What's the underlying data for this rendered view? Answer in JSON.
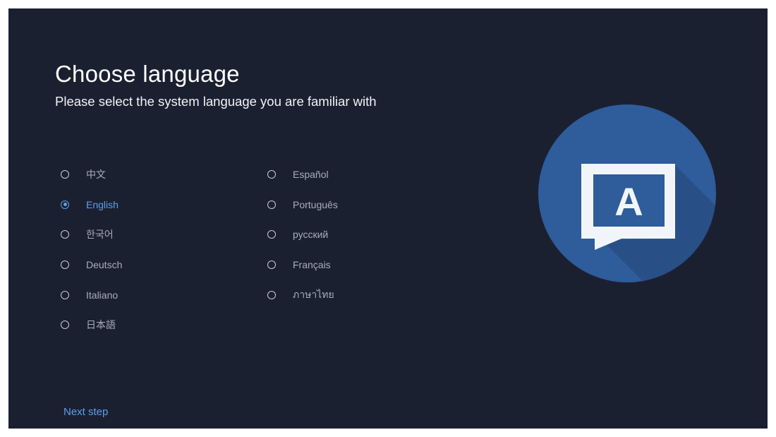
{
  "header": {
    "title": "Choose language",
    "subtitle": "Please select the system language you are familiar with"
  },
  "languages": {
    "left": [
      {
        "label": "中文",
        "selected": false
      },
      {
        "label": "English",
        "selected": true
      },
      {
        "label": "한국어",
        "selected": false
      },
      {
        "label": "Deutsch",
        "selected": false
      },
      {
        "label": "Italiano",
        "selected": false
      },
      {
        "label": "日本語",
        "selected": false
      }
    ],
    "right": [
      {
        "label": "Español",
        "selected": false
      },
      {
        "label": "Português",
        "selected": false
      },
      {
        "label": "русский",
        "selected": false
      },
      {
        "label": "Français",
        "selected": false
      },
      {
        "label": "ภาษาไทย",
        "selected": false
      }
    ]
  },
  "illustration": {
    "letter": "A",
    "icon": "language-speech-bubble-icon"
  },
  "footer": {
    "next_label": "Next step"
  },
  "colors": {
    "background": "#1b2031",
    "accent": "#5aa0ea",
    "circle": "#2f5c9a"
  }
}
